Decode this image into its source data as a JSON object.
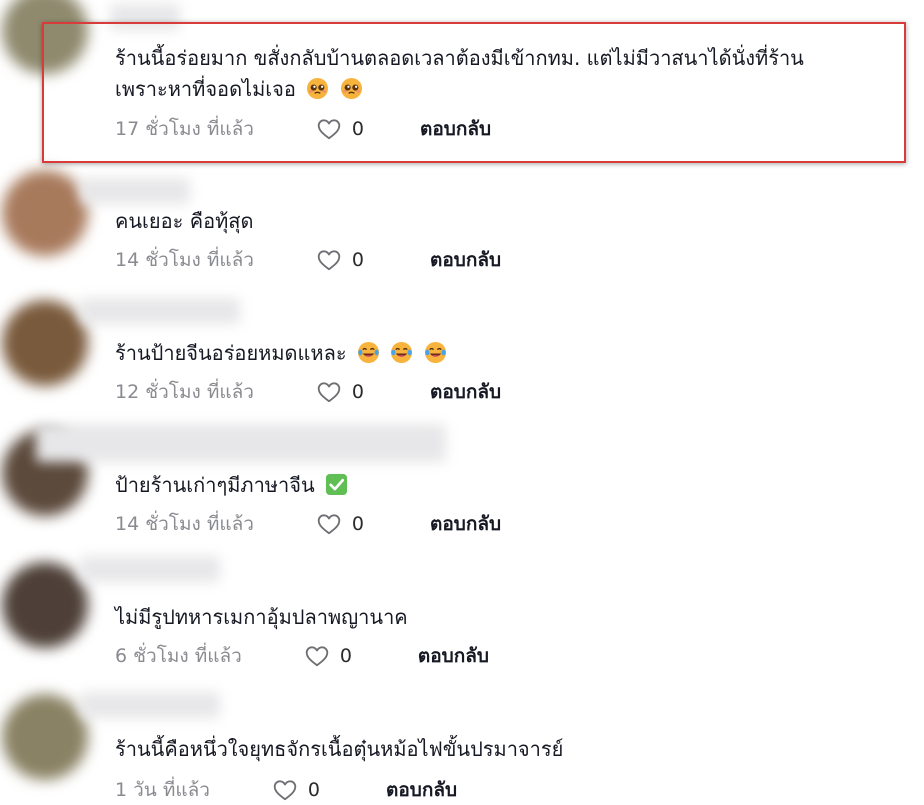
{
  "comments": [
    {
      "text_lines": [
        "ร้านนี้อร่อยมาก ขสั่งกลับบ้านตลอดเวลาต้องมีเข้ากทม. แต่ไม่มีวาสนาได้นั่งที่ร้าน",
        "เพราะหาที่จอดไม่เจอ"
      ],
      "emojis": [
        "pleading-face",
        "pleading-face"
      ],
      "time": "17 ชั่วโมง ที่แล้ว",
      "likes": "0",
      "reply": "ตอบกลับ"
    },
    {
      "text_lines": [
        "คนเยอะ คือทุ้สุด"
      ],
      "emojis": [],
      "time": "14 ชั่วโมง ที่แล้ว",
      "likes": "0",
      "reply": "ตอบกลับ"
    },
    {
      "text_lines": [
        "ร้านป้ายจีนอร่อยหมดแหละ"
      ],
      "emojis": [
        "laughing-tears-face",
        "laughing-tears-face",
        "laughing-tears-face"
      ],
      "time": "12 ชั่วโมง ที่แล้ว",
      "likes": "0",
      "reply": "ตอบกลับ"
    },
    {
      "text_lines": [
        "ป้ายร้านเก่าๆมีภาษาจีน"
      ],
      "emojis": [
        "check-mark-button"
      ],
      "time": "14 ชั่วโมง ที่แล้ว",
      "likes": "0",
      "reply": "ตอบกลับ"
    },
    {
      "text_lines": [
        "ไม่มีรูปทหารเมกาอุ้มปลาพญานาค"
      ],
      "emojis": [],
      "time": "6 ชั่วโมง ที่แล้ว",
      "likes": "0",
      "reply": "ตอบกลับ"
    },
    {
      "text_lines": [
        "ร้านนี้คือหนึ่วใจยุทธจักรเนื้อตุ๋นหม้อไฟขั้นปรมาจารย์"
      ],
      "emojis": [],
      "time": "1 วัน ที่แล้ว",
      "likes": "0",
      "reply": "ตอบกลับ"
    }
  ],
  "colors": {
    "highlight_border": "#d93b3b",
    "meta_text": "#8a8b91",
    "body_text": "#161823"
  }
}
